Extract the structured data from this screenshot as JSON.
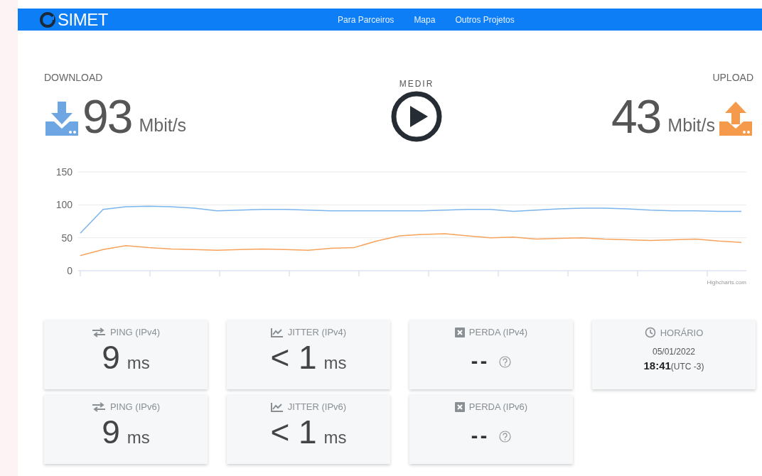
{
  "navbar": {
    "logo": "SIMET",
    "links": [
      "Para Parceiros",
      "Mapa",
      "Outros Projetos"
    ]
  },
  "download": {
    "label": "DOWNLOAD",
    "value": "93",
    "unit": "Mbit/s"
  },
  "measure": {
    "label": "MEDIR"
  },
  "upload": {
    "label": "UPLOAD",
    "value": "43",
    "unit": "Mbit/s"
  },
  "chart": {
    "credit": "Highcharts.com",
    "chart_data": {
      "type": "line",
      "ylim": [
        0,
        150
      ],
      "yticks": [
        0,
        50,
        100,
        150
      ],
      "series": [
        {
          "color": "#7cb5ec",
          "values": [
            57,
            93,
            97,
            98,
            97,
            95,
            91,
            92,
            93,
            93,
            92,
            91,
            91,
            91,
            91,
            91,
            92,
            93,
            93,
            90,
            92,
            94,
            95,
            95,
            94,
            92,
            91,
            91,
            90,
            90
          ]
        },
        {
          "color": "#f7a35c",
          "values": [
            23,
            32,
            38,
            35,
            33,
            32,
            31,
            32,
            33,
            32,
            31,
            34,
            35,
            45,
            53,
            55,
            56,
            53,
            50,
            51,
            48,
            49,
            50,
            48,
            47,
            46,
            47,
            48,
            45,
            43
          ]
        }
      ]
    }
  },
  "cards": [
    {
      "kind": "ping",
      "title": "PING (IPv4)",
      "value": "9",
      "unit": "ms"
    },
    {
      "kind": "jitter",
      "title": "JITTER (IPv4)",
      "value": "< 1",
      "unit": "ms"
    },
    {
      "kind": "loss",
      "title": "PERDA (IPv4)",
      "value": "--"
    },
    {
      "kind": "time",
      "title": "HORÁRIO",
      "date": "05/01/2022",
      "time": "18:41",
      "zone": "(UTC -3)"
    },
    {
      "kind": "ping",
      "title": "PING (IPv6)",
      "value": "9",
      "unit": "ms"
    },
    {
      "kind": "jitter",
      "title": "JITTER (IPv6)",
      "value": "< 1",
      "unit": "ms"
    },
    {
      "kind": "loss",
      "title": "PERDA (IPv6)",
      "value": "--"
    }
  ]
}
